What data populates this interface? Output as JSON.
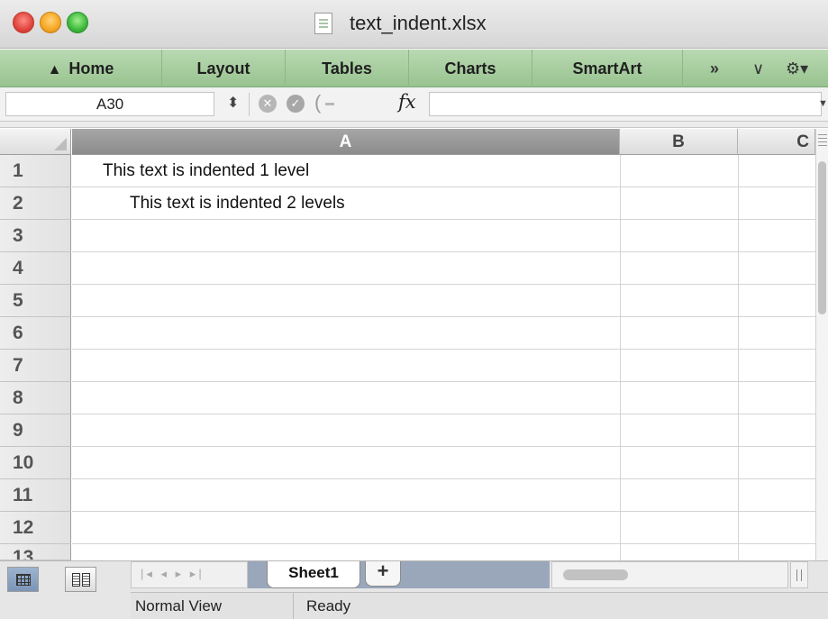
{
  "window": {
    "title": "text_indent.xlsx"
  },
  "ribbon": {
    "tabs": [
      "Home",
      "Layout",
      "Tables",
      "Charts",
      "SmartArt"
    ],
    "more_label": "»",
    "collapse_label": "∨",
    "settings_label": "⚙▾",
    "color": "#a9cf9f"
  },
  "formula_bar": {
    "name_box": "A30",
    "formula": "",
    "fx_label": "fx"
  },
  "grid": {
    "columns": [
      "A",
      "B",
      "C"
    ],
    "active_column": "A",
    "rows": [
      "1",
      "2",
      "3",
      "4",
      "5",
      "6",
      "7",
      "8",
      "9",
      "10",
      "11",
      "12",
      "13"
    ],
    "cells": {
      "A1": "This text is indented 1 level",
      "A2": "This text is indented 2 levels"
    }
  },
  "sheets": {
    "tabs": [
      "Sheet1"
    ],
    "add_label": "+"
  },
  "status": {
    "view": "Normal View",
    "state": "Ready"
  }
}
